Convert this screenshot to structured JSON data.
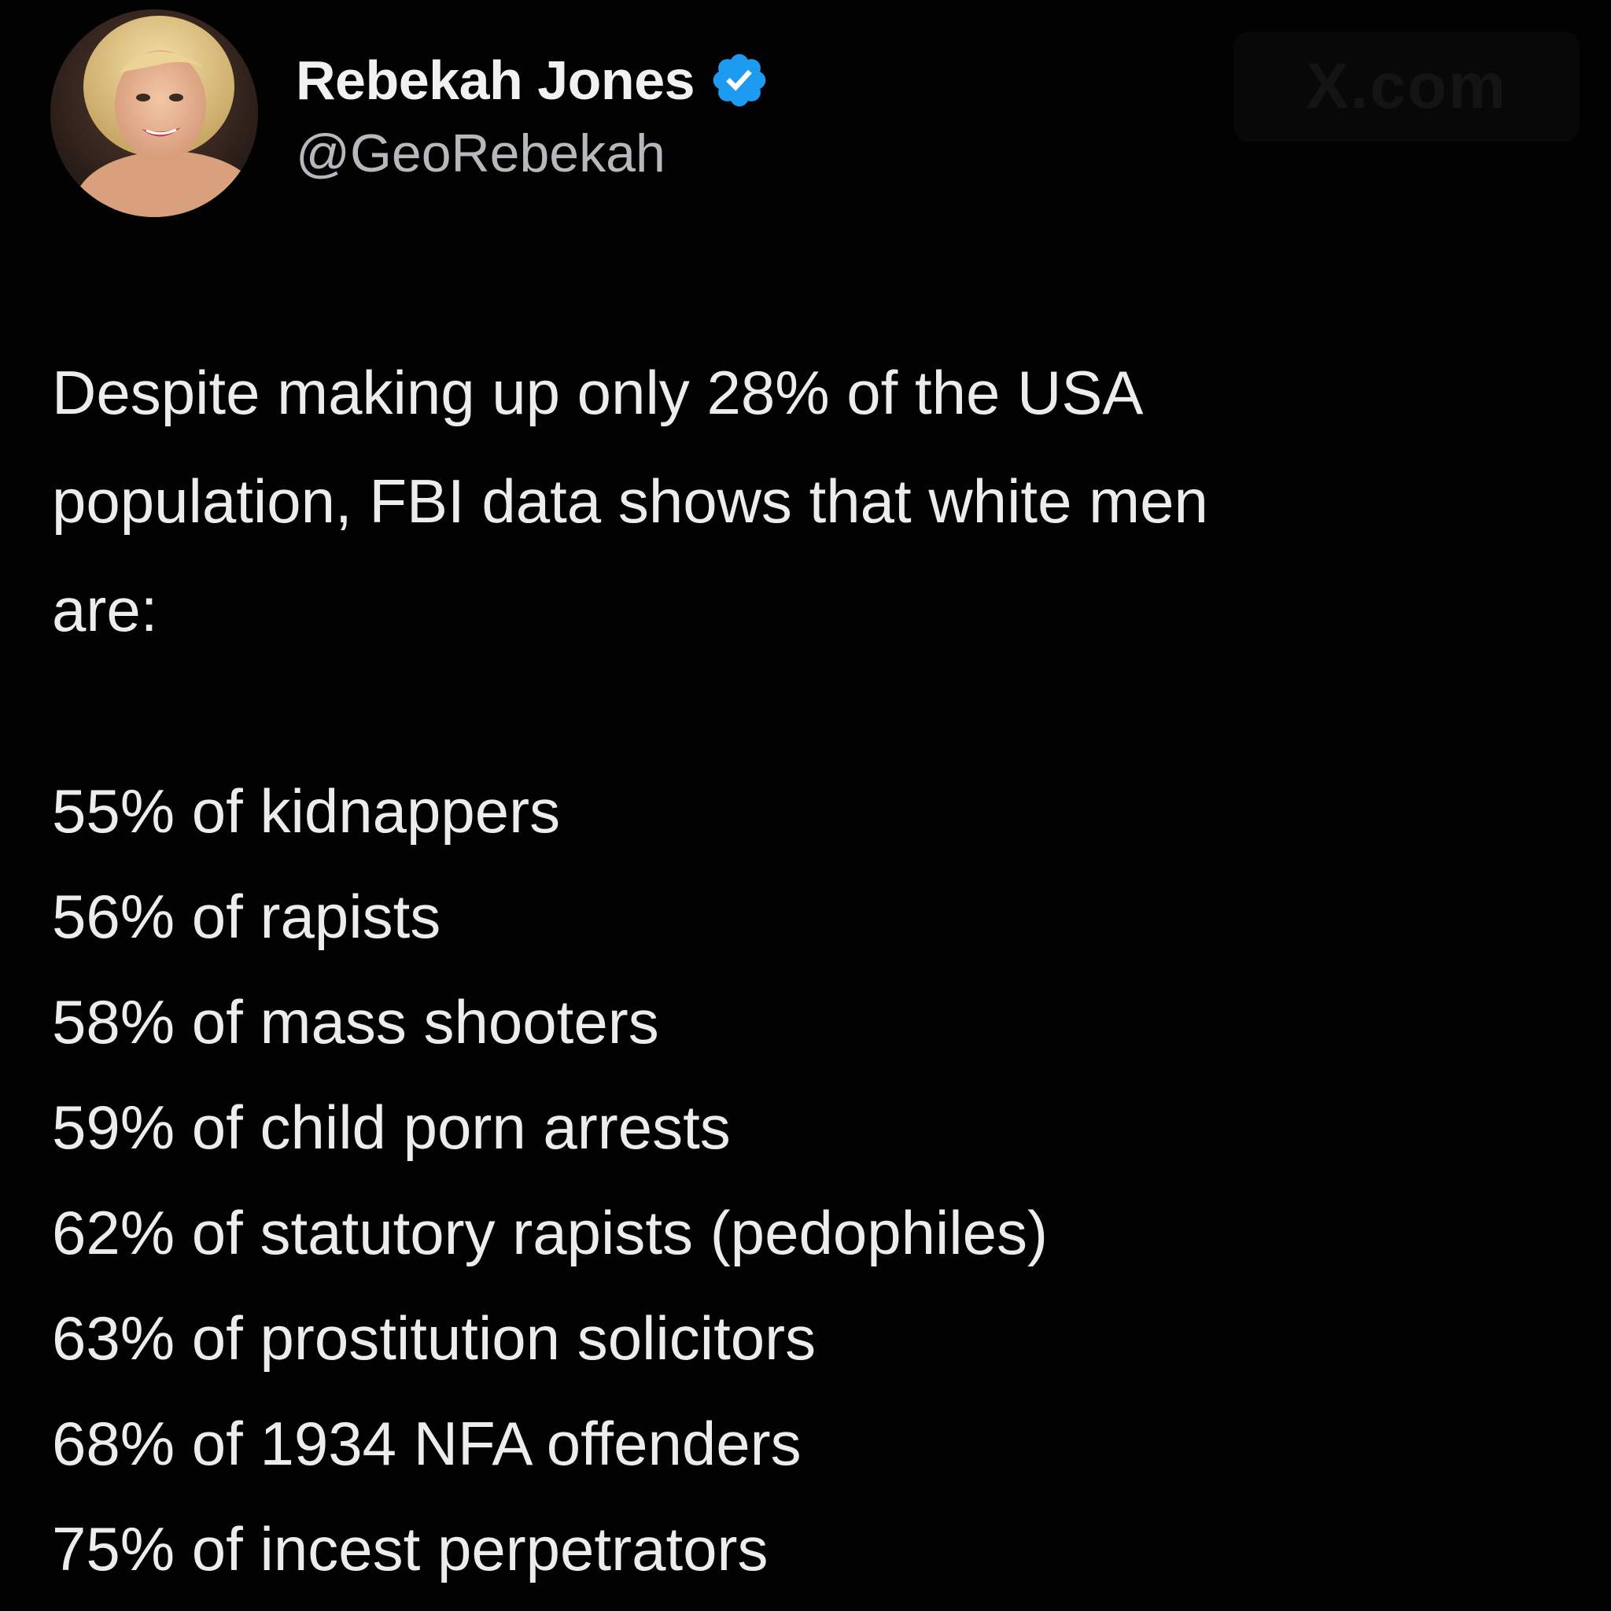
{
  "post": {
    "author": {
      "display_name": "Rebekah Jones",
      "handle": "@GeoRebekah",
      "verified": true
    },
    "watermark": "X.com",
    "intro": "Despite making up only 28% of the USA\npopulation, FBI data shows that white men\nare:",
    "stats": [
      {
        "text": "55% of kidnappers"
      },
      {
        "text": "56% of rapists"
      },
      {
        "text": "58% of mass shooters"
      },
      {
        "text": "59% of child porn arrests"
      },
      {
        "text": "62% of statutory rapists (pedophiles)"
      },
      {
        "text": "63% of prostitution solicitors"
      },
      {
        "text": "68% of 1934 NFA offenders"
      },
      {
        "text": "75% of incest perpetrators"
      }
    ]
  },
  "colors": {
    "background": "#020202",
    "text": "#ececec",
    "handle": "#b6b9bc",
    "verified_badge": "#1d9bf0"
  },
  "icons": {
    "verified": "verified-badge-icon",
    "avatar": "profile-photo"
  }
}
